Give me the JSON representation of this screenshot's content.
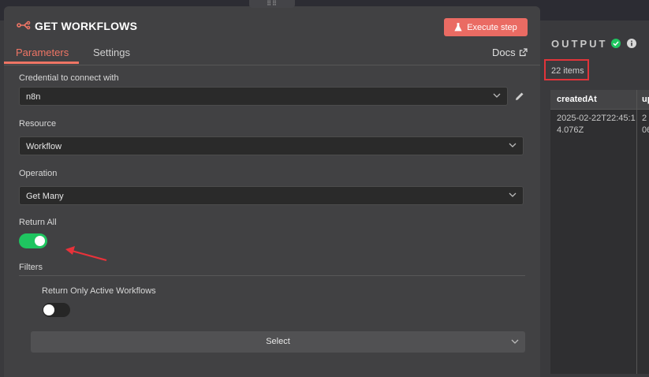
{
  "header": {
    "title": "GET WORKFLOWS",
    "execute_label": "Execute step",
    "tabs": [
      {
        "label": "Parameters"
      },
      {
        "label": "Settings"
      }
    ],
    "docs_label": "Docs"
  },
  "fields": {
    "credential": {
      "label": "Credential to connect with",
      "value": "n8n"
    },
    "resource": {
      "label": "Resource",
      "value": "Workflow"
    },
    "operation": {
      "label": "Operation",
      "value": "Get Many"
    },
    "return_all": {
      "label": "Return All",
      "on": true
    },
    "filters": {
      "label": "Filters"
    },
    "active_only": {
      "label": "Return Only Active Workflows",
      "on": false
    },
    "select_label": "Select"
  },
  "output": {
    "title": "OUTPUT",
    "items_label": "22 items",
    "columns": [
      "createdAt",
      "up"
    ],
    "rows": [
      [
        "2025-02-22T22:45:14.076Z",
        "2 06"
      ]
    ]
  },
  "colors": {
    "accent": "#ef7565",
    "toggle_on": "#1fc560",
    "highlight": "#e0343a"
  }
}
